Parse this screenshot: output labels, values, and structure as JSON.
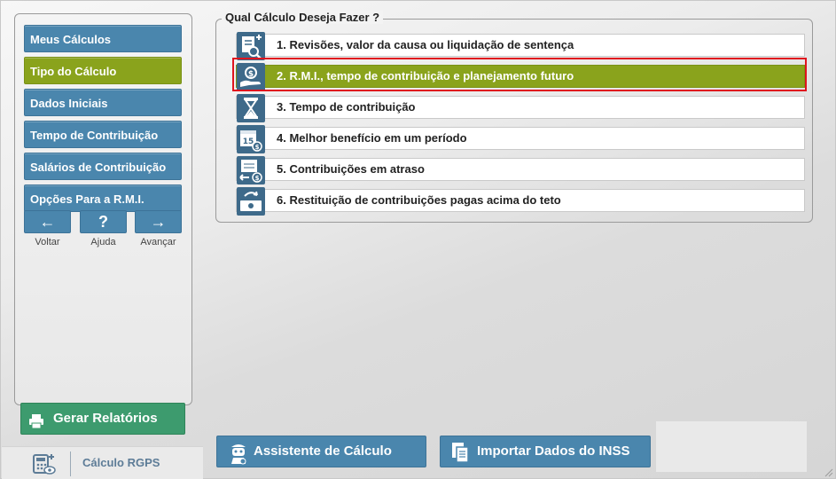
{
  "colors": {
    "nav_blue": "#4a86ad",
    "active_green": "#8aa31c",
    "report_green": "#3d9b6e",
    "selection_red": "#e0141e",
    "icon_blue": "#3e6a8a"
  },
  "sidebar": {
    "items": [
      {
        "label": "Meus Cálculos",
        "active": false
      },
      {
        "label": "Tipo do Cálculo",
        "active": true
      },
      {
        "label": "Dados Iniciais",
        "active": false
      },
      {
        "label": "Tempo de Contribuição",
        "active": false
      },
      {
        "label": "Salários de Contribuição",
        "active": false
      },
      {
        "label": "Opções Para a R.M.I.",
        "active": false
      }
    ],
    "nav": {
      "back": {
        "symbol": "←",
        "label": "Voltar",
        "icon": "arrow-left-icon"
      },
      "help": {
        "symbol": "?",
        "label": "Ajuda",
        "icon": "question-icon"
      },
      "next": {
        "symbol": "→",
        "label": "Avançar",
        "icon": "arrow-right-icon"
      }
    },
    "report_button": {
      "label": "Gerar Relatórios",
      "icon": "printer-icon"
    },
    "logo": {
      "text": "Cálculo RGPS",
      "icon": "calculator-eye-icon"
    }
  },
  "main": {
    "group_title": "Qual Cálculo Deseja Fazer ?",
    "options": [
      {
        "label": "1. Revisões, valor da causa ou liquidação de sentença",
        "icon": "document-search-icon",
        "selected": false
      },
      {
        "label": "2. R.M.I., tempo de contribuição e planejamento futuro",
        "icon": "hand-money-icon",
        "selected": true
      },
      {
        "label": "3. Tempo de contribuição",
        "icon": "hourglass-icon",
        "selected": false
      },
      {
        "label": "4. Melhor benefício em um período",
        "icon": "calendar-money-icon",
        "selected": false
      },
      {
        "label": "5. Contribuições em atraso",
        "icon": "calendar-transfer-icon",
        "selected": false
      },
      {
        "label": "6. Restituição de contribuições pagas acima do teto",
        "icon": "cash-return-icon",
        "selected": false
      }
    ]
  },
  "footer": {
    "assistant_button": {
      "label": "Assistente de Cálculo",
      "icon": "assistant-robot-icon"
    },
    "import_button": {
      "label": "Importar Dados do INSS",
      "icon": "documents-icon"
    }
  }
}
